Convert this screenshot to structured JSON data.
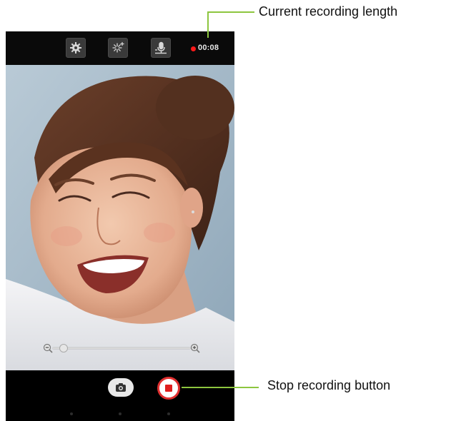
{
  "topbar": {
    "settings_icon": "gear-icon",
    "effects_icon": "sparkle-icon",
    "mic_icon": "microphone-icon",
    "recording_time": "00:08",
    "recording_color": "#ff1a1a"
  },
  "viewfinder": {
    "zoom": {
      "out_icon": "zoom-out-icon",
      "in_icon": "zoom-in-icon",
      "level": 0.05
    }
  },
  "bottombar": {
    "snapshot_icon": "camera-icon",
    "stop_icon": "stop-icon",
    "stop_color": "#e03030"
  },
  "callouts": {
    "recording_length": "Current recording length",
    "stop_button": "Stop recording button",
    "line_color": "#8dc63f"
  }
}
